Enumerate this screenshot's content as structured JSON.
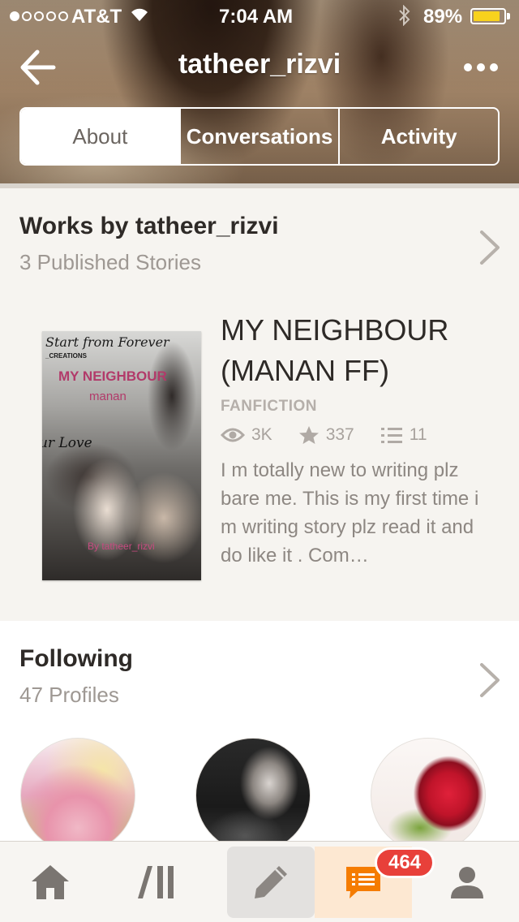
{
  "status_bar": {
    "carrier": "AT&T",
    "time": "7:04 AM",
    "battery_percent": "89%",
    "battery_level": 0.89,
    "signal_bars_filled": 1,
    "signal_bars_total": 5
  },
  "header": {
    "username": "tatheer_rizvi",
    "back_icon": "back-arrow-icon",
    "more_icon": "more-dots-icon"
  },
  "tabs": {
    "about": "About",
    "conversations": "Conversations",
    "activity": "Activity",
    "selected": "About"
  },
  "works": {
    "title": "Works by tatheer_rizvi",
    "subtitle": "3 Published Stories",
    "story": {
      "title": "MY NEIGHBOUR (MANAN FF)",
      "category": "FANFICTION",
      "views": "3K",
      "votes": "337",
      "parts": "11",
      "description": "I m totally new to writing plz bare me. This is my first time i m writing story plz read it and do like it . Com…",
      "cover": {
        "line1": "Start from Forever",
        "line2": "_CREATIONS",
        "line3": "MY NEIGHBOUR",
        "line4": "manan",
        "line5": "ur Love",
        "line6": "By tatheer_rizvi"
      }
    }
  },
  "following": {
    "title": "Following",
    "subtitle": "47 Profiles"
  },
  "tab_bar": {
    "items": [
      "home-icon",
      "library-icon",
      "write-icon",
      "messages-icon",
      "profile-icon"
    ],
    "notification_count": "464",
    "accent_color": "#f57c00"
  }
}
